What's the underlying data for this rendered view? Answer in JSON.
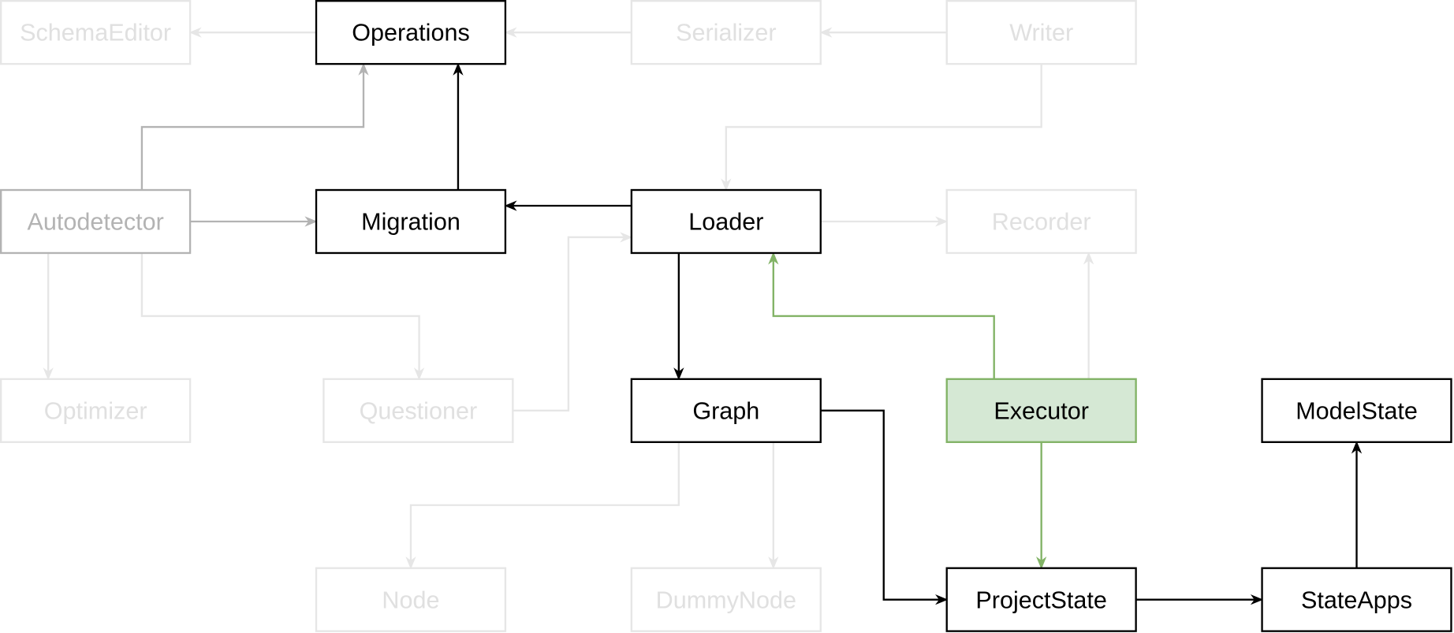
{
  "colors": {
    "active_stroke": "#000000",
    "secondary_stroke": "#b3b3b3",
    "faded_stroke": "#e6e6e6",
    "faded_text": "#e0e0e0",
    "highlight_fill": "#d5e8d4",
    "highlight_stroke": "#82b366"
  },
  "nodes": [
    {
      "id": "schemaeditor",
      "label": "SchemaEditor",
      "style": "faded"
    },
    {
      "id": "operations",
      "label": "Operations",
      "style": "active"
    },
    {
      "id": "serializer",
      "label": "Serializer",
      "style": "faded"
    },
    {
      "id": "writer",
      "label": "Writer",
      "style": "faded"
    },
    {
      "id": "autodetector",
      "label": "Autodetector",
      "style": "secondary"
    },
    {
      "id": "migration",
      "label": "Migration",
      "style": "active"
    },
    {
      "id": "loader",
      "label": "Loader",
      "style": "active"
    },
    {
      "id": "recorder",
      "label": "Recorder",
      "style": "faded"
    },
    {
      "id": "optimizer",
      "label": "Optimizer",
      "style": "faded"
    },
    {
      "id": "questioner",
      "label": "Questioner",
      "style": "faded"
    },
    {
      "id": "graph",
      "label": "Graph",
      "style": "active"
    },
    {
      "id": "executor",
      "label": "Executor",
      "style": "highlight"
    },
    {
      "id": "modelstate",
      "label": "ModelState",
      "style": "active"
    },
    {
      "id": "node",
      "label": "Node",
      "style": "faded"
    },
    {
      "id": "dummynode",
      "label": "DummyNode",
      "style": "faded"
    },
    {
      "id": "projectstate",
      "label": "ProjectState",
      "style": "active"
    },
    {
      "id": "stateapps",
      "label": "StateApps",
      "style": "active"
    }
  ],
  "edges": [
    {
      "from": "operations",
      "to": "schemaeditor",
      "style": "faded"
    },
    {
      "from": "serializer",
      "to": "operations",
      "style": "faded"
    },
    {
      "from": "writer",
      "to": "serializer",
      "style": "faded"
    },
    {
      "from": "writer",
      "to": "loader",
      "style": "faded"
    },
    {
      "from": "autodetector",
      "to": "operations",
      "style": "secondary"
    },
    {
      "from": "migration",
      "to": "operations",
      "style": "active"
    },
    {
      "from": "loader",
      "to": "migration",
      "style": "active"
    },
    {
      "from": "autodetector",
      "to": "migration",
      "style": "secondary"
    },
    {
      "from": "loader",
      "to": "recorder",
      "style": "faded"
    },
    {
      "from": "questioner",
      "to": "loader",
      "style": "faded"
    },
    {
      "from": "autodetector",
      "to": "optimizer",
      "style": "faded"
    },
    {
      "from": "autodetector",
      "to": "questioner",
      "style": "faded"
    },
    {
      "from": "loader",
      "to": "graph",
      "style": "active"
    },
    {
      "from": "executor",
      "to": "loader",
      "style": "highlight"
    },
    {
      "from": "executor",
      "to": "recorder",
      "style": "faded"
    },
    {
      "from": "graph",
      "to": "projectstate",
      "style": "active"
    },
    {
      "from": "executor",
      "to": "projectstate",
      "style": "highlight"
    },
    {
      "from": "graph",
      "to": "node",
      "style": "faded"
    },
    {
      "from": "graph",
      "to": "dummynode",
      "style": "faded"
    },
    {
      "from": "projectstate",
      "to": "stateapps",
      "style": "active"
    },
    {
      "from": "stateapps",
      "to": "modelstate",
      "style": "active"
    }
  ]
}
